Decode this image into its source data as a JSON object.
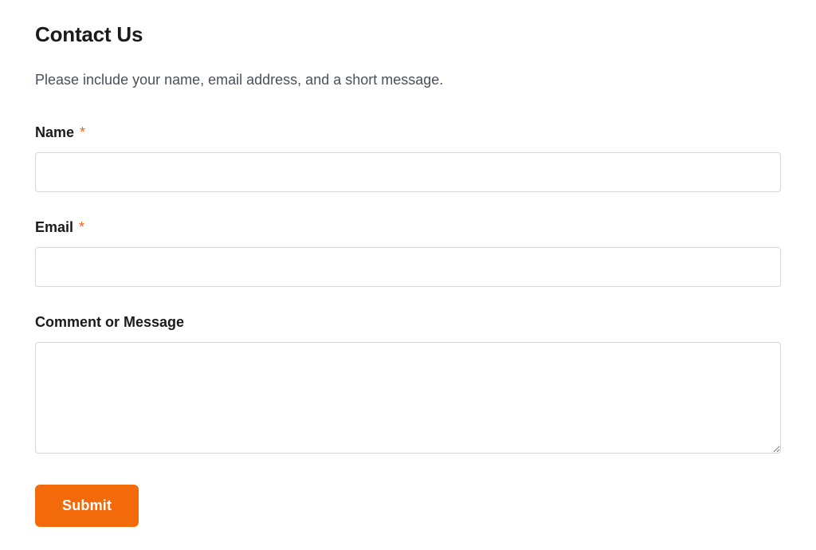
{
  "header": {
    "title": "Contact Us",
    "intro": "Please include your name, email address, and a short message."
  },
  "form": {
    "name": {
      "label": "Name",
      "required_mark": "*",
      "value": ""
    },
    "email": {
      "label": "Email",
      "required_mark": "*",
      "value": ""
    },
    "message": {
      "label": "Comment or Message",
      "value": ""
    },
    "submit_label": "Submit"
  }
}
